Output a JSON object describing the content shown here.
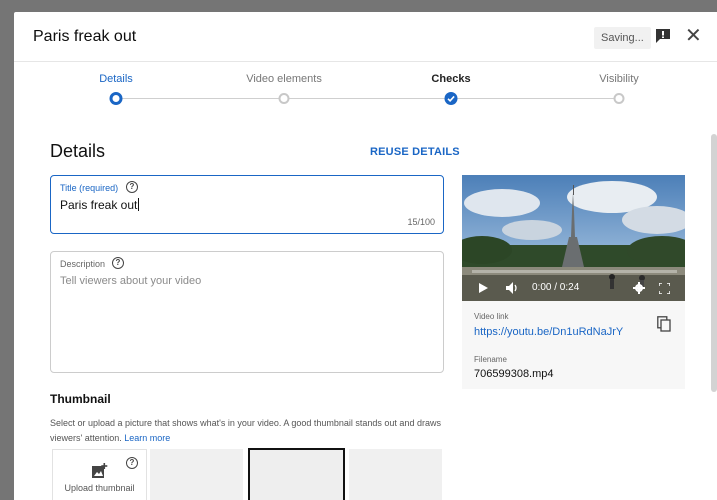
{
  "dialog": {
    "title": "Paris freak out",
    "saving_label": "Saving...",
    "close_glyph": "✕"
  },
  "stepper": {
    "steps": [
      {
        "label": "Details",
        "state": "current"
      },
      {
        "label": "Video elements",
        "state": "todo"
      },
      {
        "label": "Checks",
        "state": "done"
      },
      {
        "label": "Visibility",
        "state": "todo"
      }
    ]
  },
  "details": {
    "heading": "Details",
    "reuse_label": "REUSE DETAILS",
    "title_field": {
      "label": "Title (required)",
      "value": "Paris freak out",
      "counter": "15/100"
    },
    "description_field": {
      "label": "Description",
      "placeholder": "Tell viewers about your video"
    },
    "help_glyph": "?"
  },
  "video": {
    "time": "0:00 / 0:24",
    "link_label": "Video link",
    "link": "https://youtu.be/Dn1uRdNaJrY",
    "filename_label": "Filename",
    "filename": "706599308.mp4"
  },
  "thumbnail": {
    "heading": "Thumbnail",
    "description": "Select or upload a picture that shows what's in your video. A good thumbnail stands out and draws viewers' attention.",
    "learn_more": "Learn more",
    "upload_label": "Upload thumbnail"
  },
  "colors": {
    "accent": "#1a66c5",
    "backdrop": "#757575"
  }
}
